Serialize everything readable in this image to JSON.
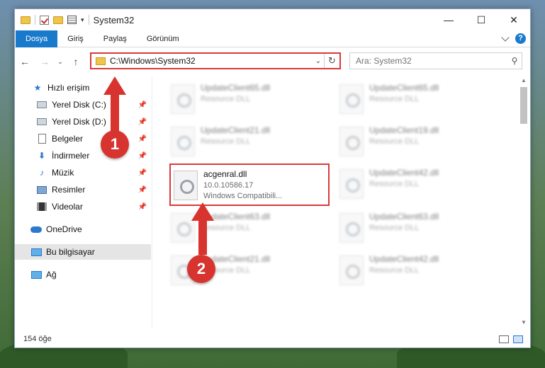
{
  "window": {
    "title": "System32",
    "controls": {
      "minimize": "—",
      "maximize": "☐",
      "close": "✕"
    }
  },
  "ribbon": {
    "tabs": [
      "Dosya",
      "Giriş",
      "Paylaş",
      "Görünüm"
    ],
    "help": "?"
  },
  "address": {
    "path": "C:\\Windows\\System32",
    "search_placeholder": "Ara: System32"
  },
  "nav": {
    "back": "←",
    "forward": "→",
    "recent": "⌄",
    "up": "↑"
  },
  "sidebar": {
    "quick_access": "Hızlı erişim",
    "items": [
      {
        "label": "Yerel Disk (C:)",
        "icon": "drive-icon"
      },
      {
        "label": "Yerel Disk (D:)",
        "icon": "drive-icon"
      },
      {
        "label": "Belgeler",
        "icon": "documents-icon"
      },
      {
        "label": "İndirmeler",
        "icon": "downloads-icon"
      },
      {
        "label": "Müzik",
        "icon": "music-icon"
      },
      {
        "label": "Resimler",
        "icon": "pictures-icon"
      },
      {
        "label": "Videolar",
        "icon": "videos-icon"
      }
    ],
    "onedrive": "OneDrive",
    "this_pc": "Bu bilgisayar",
    "network": "Ağ"
  },
  "files": [
    {
      "name": "UpdateClient65.dll",
      "sub": "Resource DLL"
    },
    {
      "name": "UpdateClient65.dll",
      "sub": "Resource DLL"
    },
    {
      "name": "UpdateClient21.dll",
      "sub": "Resource DLL"
    },
    {
      "name": "UpdateClient19.dll",
      "sub": "Resource DLL"
    },
    {
      "name": "acgenral.dll",
      "version": "10.0.10586.17",
      "sub": "Windows Compatibili..."
    },
    {
      "name": "UpdateClient42.dll",
      "sub": "Resource DLL"
    },
    {
      "name": "UpdateClient63.dll",
      "sub": "Resource DLL"
    },
    {
      "name": "UpdateClient63.dll",
      "sub": "Resource DLL"
    },
    {
      "name": "UpdateClient21.dll",
      "sub": "Resource DLL"
    },
    {
      "name": "UpdateClient42.dll",
      "sub": "Resource DLL"
    }
  ],
  "status": {
    "count": "154 öğe"
  },
  "annotations": {
    "step1": "1",
    "step2": "2",
    "color": "#d8342f"
  }
}
